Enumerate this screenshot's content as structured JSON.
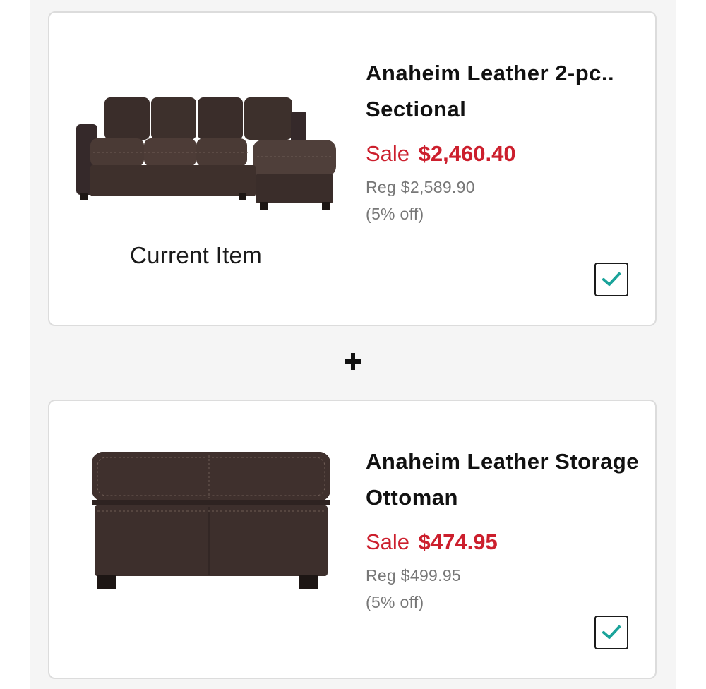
{
  "items": [
    {
      "title": "Anaheim Leather 2-pc.. Sectional",
      "sale_label": "Sale",
      "sale_price": "$2,460.40",
      "reg_price": "Reg $2,589.90",
      "discount": "(5% off)",
      "caption": "Current Item",
      "image": "sectional-sofa",
      "checked": true
    },
    {
      "title": "Anaheim Leather Storage Ottoman",
      "sale_label": "Sale",
      "sale_price": "$474.95",
      "reg_price": "Reg $499.95",
      "discount": "(5% off)",
      "image": "storage-ottoman",
      "checked": true
    }
  ],
  "separator_icon": "plus-icon",
  "colors": {
    "sale": "#cc1f2d",
    "check": "#1aa39a",
    "leather": "#3e302c"
  }
}
